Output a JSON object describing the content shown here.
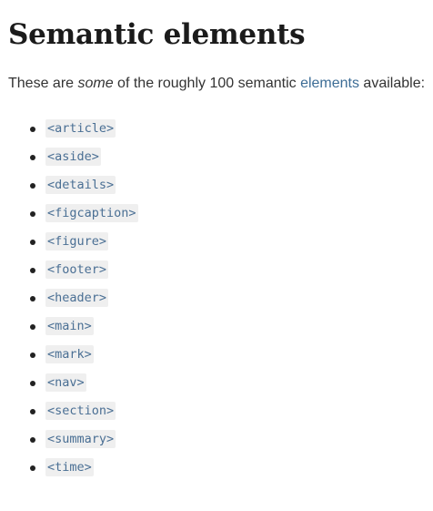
{
  "title": "Semantic elements",
  "intro": {
    "before": "These are ",
    "emphasis": "some",
    "middle": " of the roughly 100 semantic ",
    "link": "elements",
    "after": " available:"
  },
  "elements": [
    "<article>",
    "<aside>",
    "<details>",
    "<figcaption>",
    "<figure>",
    "<footer>",
    "<header>",
    "<main>",
    "<mark>",
    "<nav>",
    "<section>",
    "<summary>",
    "<time>"
  ],
  "colors": {
    "link": "#3d6d96",
    "code_text": "#4a6f94",
    "code_background": "#efefef",
    "heading": "#1b1b1b",
    "body_text": "#333333"
  }
}
